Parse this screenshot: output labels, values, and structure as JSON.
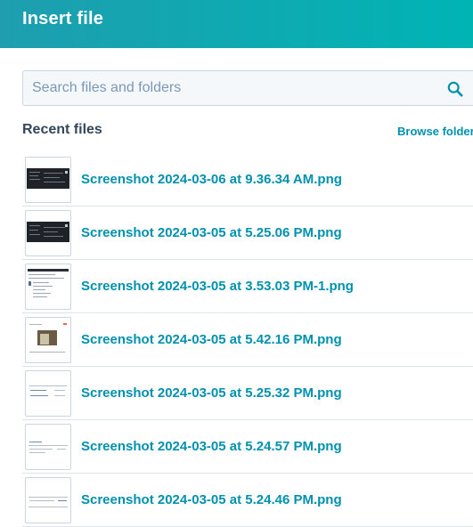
{
  "header": {
    "title": "Insert file"
  },
  "search": {
    "placeholder": "Search files and folders",
    "value": "",
    "icon": "search-icon"
  },
  "recent": {
    "title": "Recent files",
    "browse_label": "Browse folders",
    "files": [
      {
        "name": "Screenshot 2024-03-06 at 9.36.34 AM.png"
      },
      {
        "name": "Screenshot 2024-03-05 at 5.25.06 PM.png"
      },
      {
        "name": "Screenshot 2024-03-05 at 3.53.03 PM-1.png"
      },
      {
        "name": "Screenshot 2024-03-05 at 5.42.16 PM.png"
      },
      {
        "name": "Screenshot 2024-03-05 at 5.25.32 PM.png"
      },
      {
        "name": "Screenshot 2024-03-05 at 5.24.57 PM.png"
      },
      {
        "name": "Screenshot 2024-03-05 at 5.24.46 PM.png"
      }
    ]
  },
  "colors": {
    "header_start": "#1e9eaf",
    "header_end": "#00b4b4",
    "link": "#0091ae",
    "text": "#33475b",
    "divider": "#dfe3eb"
  }
}
